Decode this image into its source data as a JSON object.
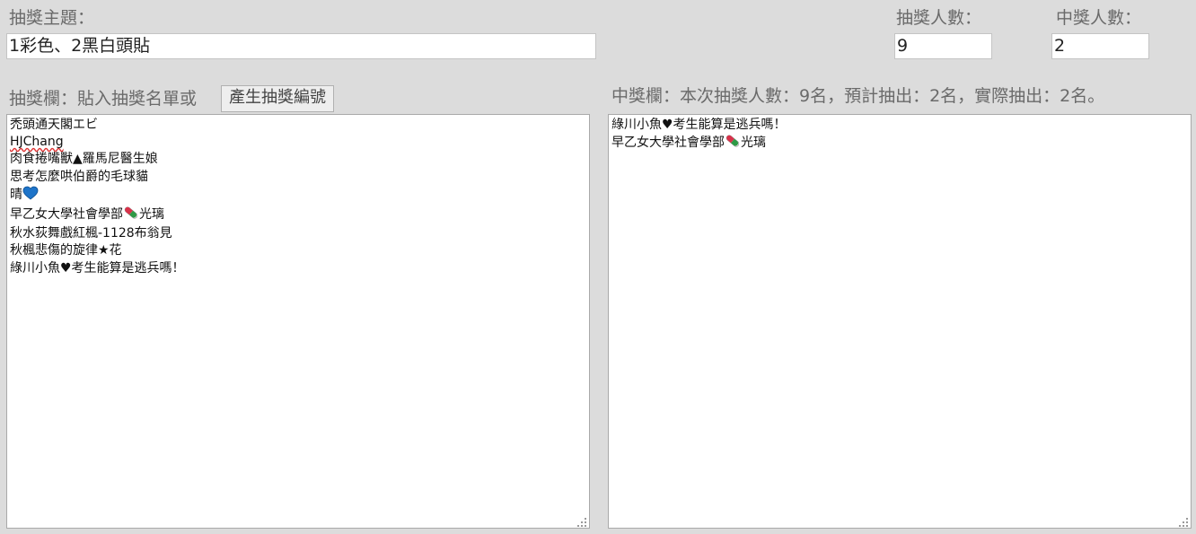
{
  "topic": {
    "label": "抽獎主題：",
    "value": "1彩色、2黑白頭貼"
  },
  "participants_count": {
    "label": "抽獎人數：",
    "value": "9"
  },
  "winners_count": {
    "label": "中獎人數：",
    "value": "2"
  },
  "entry_panel": {
    "label": "抽獎欄：貼入抽獎名單或",
    "generate_button": "產生抽獎編號",
    "entries": [
      "禿頭通天閣エビ",
      "HJChang",
      "肉食捲嘴獸▲羅馬尼醫生娘",
      "思考怎麼哄伯爵的毛球貓",
      "晴",
      "早乙女大學社會學部",
      "秋水荻舞戲紅楓-1128布翁見",
      "秋楓悲傷的旋律★花",
      "綠川小魚♥考生能算是逃兵嗎！"
    ],
    "entry_suffix_6": "光璃"
  },
  "winner_panel": {
    "label": "中獎欄：本次抽獎人數：9名，預計抽出：2名，實際抽出：2名。",
    "winners": [
      "綠川小魚♥考生能算是逃兵嗎！",
      "早乙女大學社會學部"
    ],
    "winner_suffix_2": "光璃"
  },
  "icons": {
    "heart": "blue-heart-icon",
    "pill": "pill-icon",
    "grip": "resize-grip-icon"
  },
  "colors": {
    "background": "#dcdcdc",
    "label": "#6a6a6a",
    "heart": "#1e74c9",
    "pill_red": "#d8324a",
    "pill_green": "#2e9a46"
  }
}
